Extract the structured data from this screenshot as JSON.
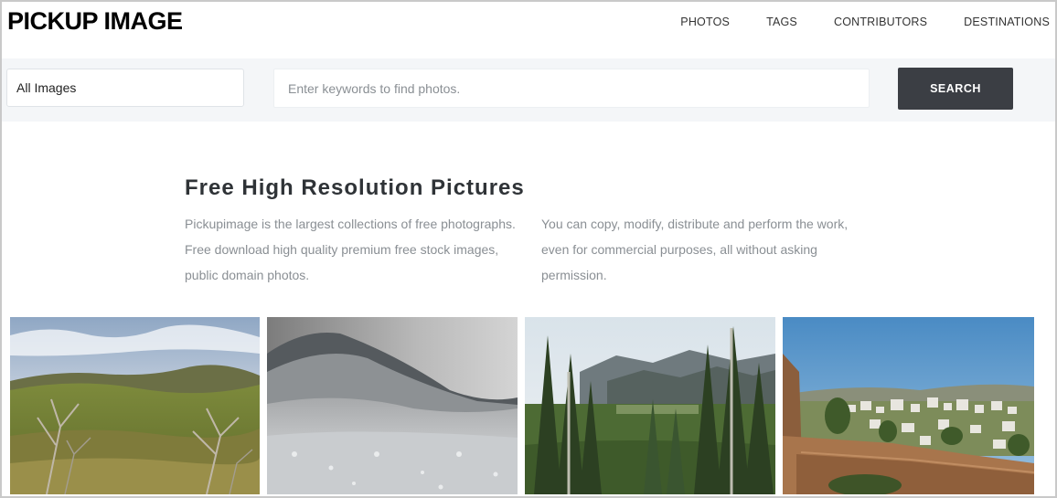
{
  "header": {
    "logo": "PICKUP IMAGE",
    "nav": [
      {
        "label": "PHOTOS"
      },
      {
        "label": "TAGS"
      },
      {
        "label": "CONTRIBUTORS"
      },
      {
        "label": "DESTINATIONS"
      }
    ]
  },
  "search": {
    "category_selected": "All Images",
    "placeholder": "Enter keywords to find photos.",
    "button_label": "SEARCH"
  },
  "intro": {
    "title": "Free High Resolution Pictures",
    "col1": "Pickupimage is the largest collections of free photographs. Free download high quality premium free stock images, public domain photos.",
    "col2": "You can copy, modify, distribute and perform the work, even for commercial purposes, all without asking permission."
  },
  "photos": [
    {
      "subject": "grassy hills with bare shrubs"
    },
    {
      "subject": "frosty mountain slope in mist"
    },
    {
      "subject": "pine forest valley with mountains"
    },
    {
      "subject": "hillside town with fortress wall"
    }
  ],
  "colors": {
    "search_button_bg": "#3b3e44",
    "searchbar_bg": "#f4f6f8",
    "title_text": "#2f3337",
    "body_text": "#8a8f94"
  }
}
